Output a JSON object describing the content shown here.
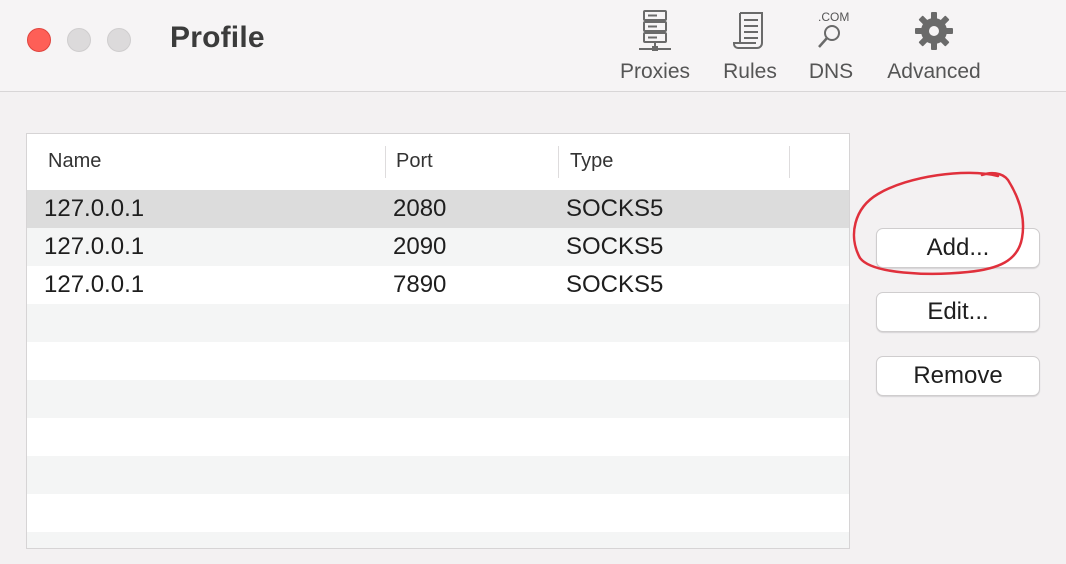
{
  "window": {
    "title": "Profile"
  },
  "toolbar": {
    "items": [
      {
        "label": "Proxies",
        "icon": "server-icon"
      },
      {
        "label": "Rules",
        "icon": "scroll-icon"
      },
      {
        "label": "DNS",
        "icon": "dns-magnifier-icon",
        "icon_text": ".COM"
      },
      {
        "label": "Advanced",
        "icon": "gear-icon"
      }
    ]
  },
  "table": {
    "columns": [
      "Name",
      "Port",
      "Type"
    ],
    "rows": [
      {
        "name": "127.0.0.1",
        "port": "2080",
        "type": "SOCKS5",
        "selected": true
      },
      {
        "name": "127.0.0.1",
        "port": "2090",
        "type": "SOCKS5",
        "selected": false
      },
      {
        "name": "127.0.0.1",
        "port": "7890",
        "type": "SOCKS5",
        "selected": false
      }
    ]
  },
  "buttons": {
    "add": "Add...",
    "edit": "Edit...",
    "remove": "Remove"
  },
  "colors": {
    "close": "#fe5f57",
    "annotation": "#e0303c",
    "selected_row": "#dcdcdc"
  }
}
